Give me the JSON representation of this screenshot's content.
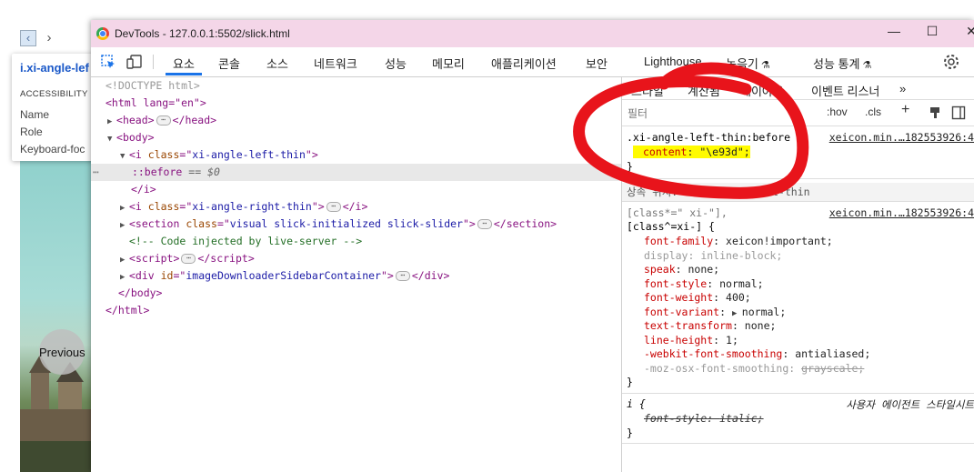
{
  "page": {
    "tooltip": {
      "title": "i.xi-angle-lef",
      "section": "ACCESSIBILITY",
      "rows": [
        "Name",
        "Role",
        "Keyboard-foc"
      ]
    },
    "previous_label": "Previous"
  },
  "window": {
    "title": "DevTools - 127.0.0.1:5502/slick.html",
    "minimize": "—",
    "maximize": "☐",
    "close": "✕"
  },
  "tabs": [
    "요소",
    "콘솔",
    "소스",
    "네트워크",
    "성능",
    "메모리",
    "애플리케이션",
    "보안",
    "Lighthouse",
    "녹음기",
    "성능 통계"
  ],
  "elements": {
    "doctype": "<!DOCTYPE html>",
    "html_open": "<html lang=\"en\">",
    "head": "head",
    "body": "body",
    "i_left_class": "xi-angle-left-thin",
    "before_pseudo": "::before",
    "before_eq": "== $0",
    "i_right_class": "xi-angle-right-thin",
    "section_class": "visual slick-initialized slick-slider",
    "comment": "<!-- Code injected by live-server -->",
    "script": "script",
    "div_id": "imageDownloaderSidebarContainer",
    "body_close": "</body>",
    "html_close": "</html>"
  },
  "styles": {
    "subtabs": [
      "스타일",
      "계산됨",
      "레이아웃",
      "이벤트 리스너",
      "»"
    ],
    "filter_placeholder": "필터",
    "hov": ":hov",
    "cls": ".cls",
    "rule1": {
      "selector": ".xi-angle-left-thin:before {",
      "source": "xeicon.min.…182553926:4",
      "prop": "content",
      "value": "\"\\e93d\";"
    },
    "inherited": "상속 위치: i.xi-angle-left-thin",
    "rule2": {
      "selector1": "[class*=\" xi-\"],",
      "selector2": "[class^=xi-] {",
      "source": "xeicon.min.…182553926:4",
      "decls": [
        {
          "p": "font-family",
          "v": "xeicon!important;"
        },
        {
          "p": "display",
          "v": "inline-block;"
        },
        {
          "p": "speak",
          "v": "none;"
        },
        {
          "p": "font-style",
          "v": "normal;"
        },
        {
          "p": "font-weight",
          "v": "400;"
        },
        {
          "p": "font-variant",
          "v": "normal;"
        },
        {
          "p": "text-transform",
          "v": "none;"
        },
        {
          "p": "line-height",
          "v": "1;"
        },
        {
          "p": "-webkit-font-smoothing",
          "v": "antialiased;"
        },
        {
          "p": "-moz-osx-font-smoothing",
          "v": "grayscale;"
        }
      ]
    },
    "rule3": {
      "selector": "i {",
      "source": "사용자 에이전트 스타일시트",
      "prop": "font-style",
      "value": "italic;"
    },
    "close_brace": "}"
  },
  "colors": {
    "titlebar": "#f4d6e8",
    "accent": "#1a73e8",
    "annotation": "#e8141b",
    "highlight": "#fffb00"
  }
}
